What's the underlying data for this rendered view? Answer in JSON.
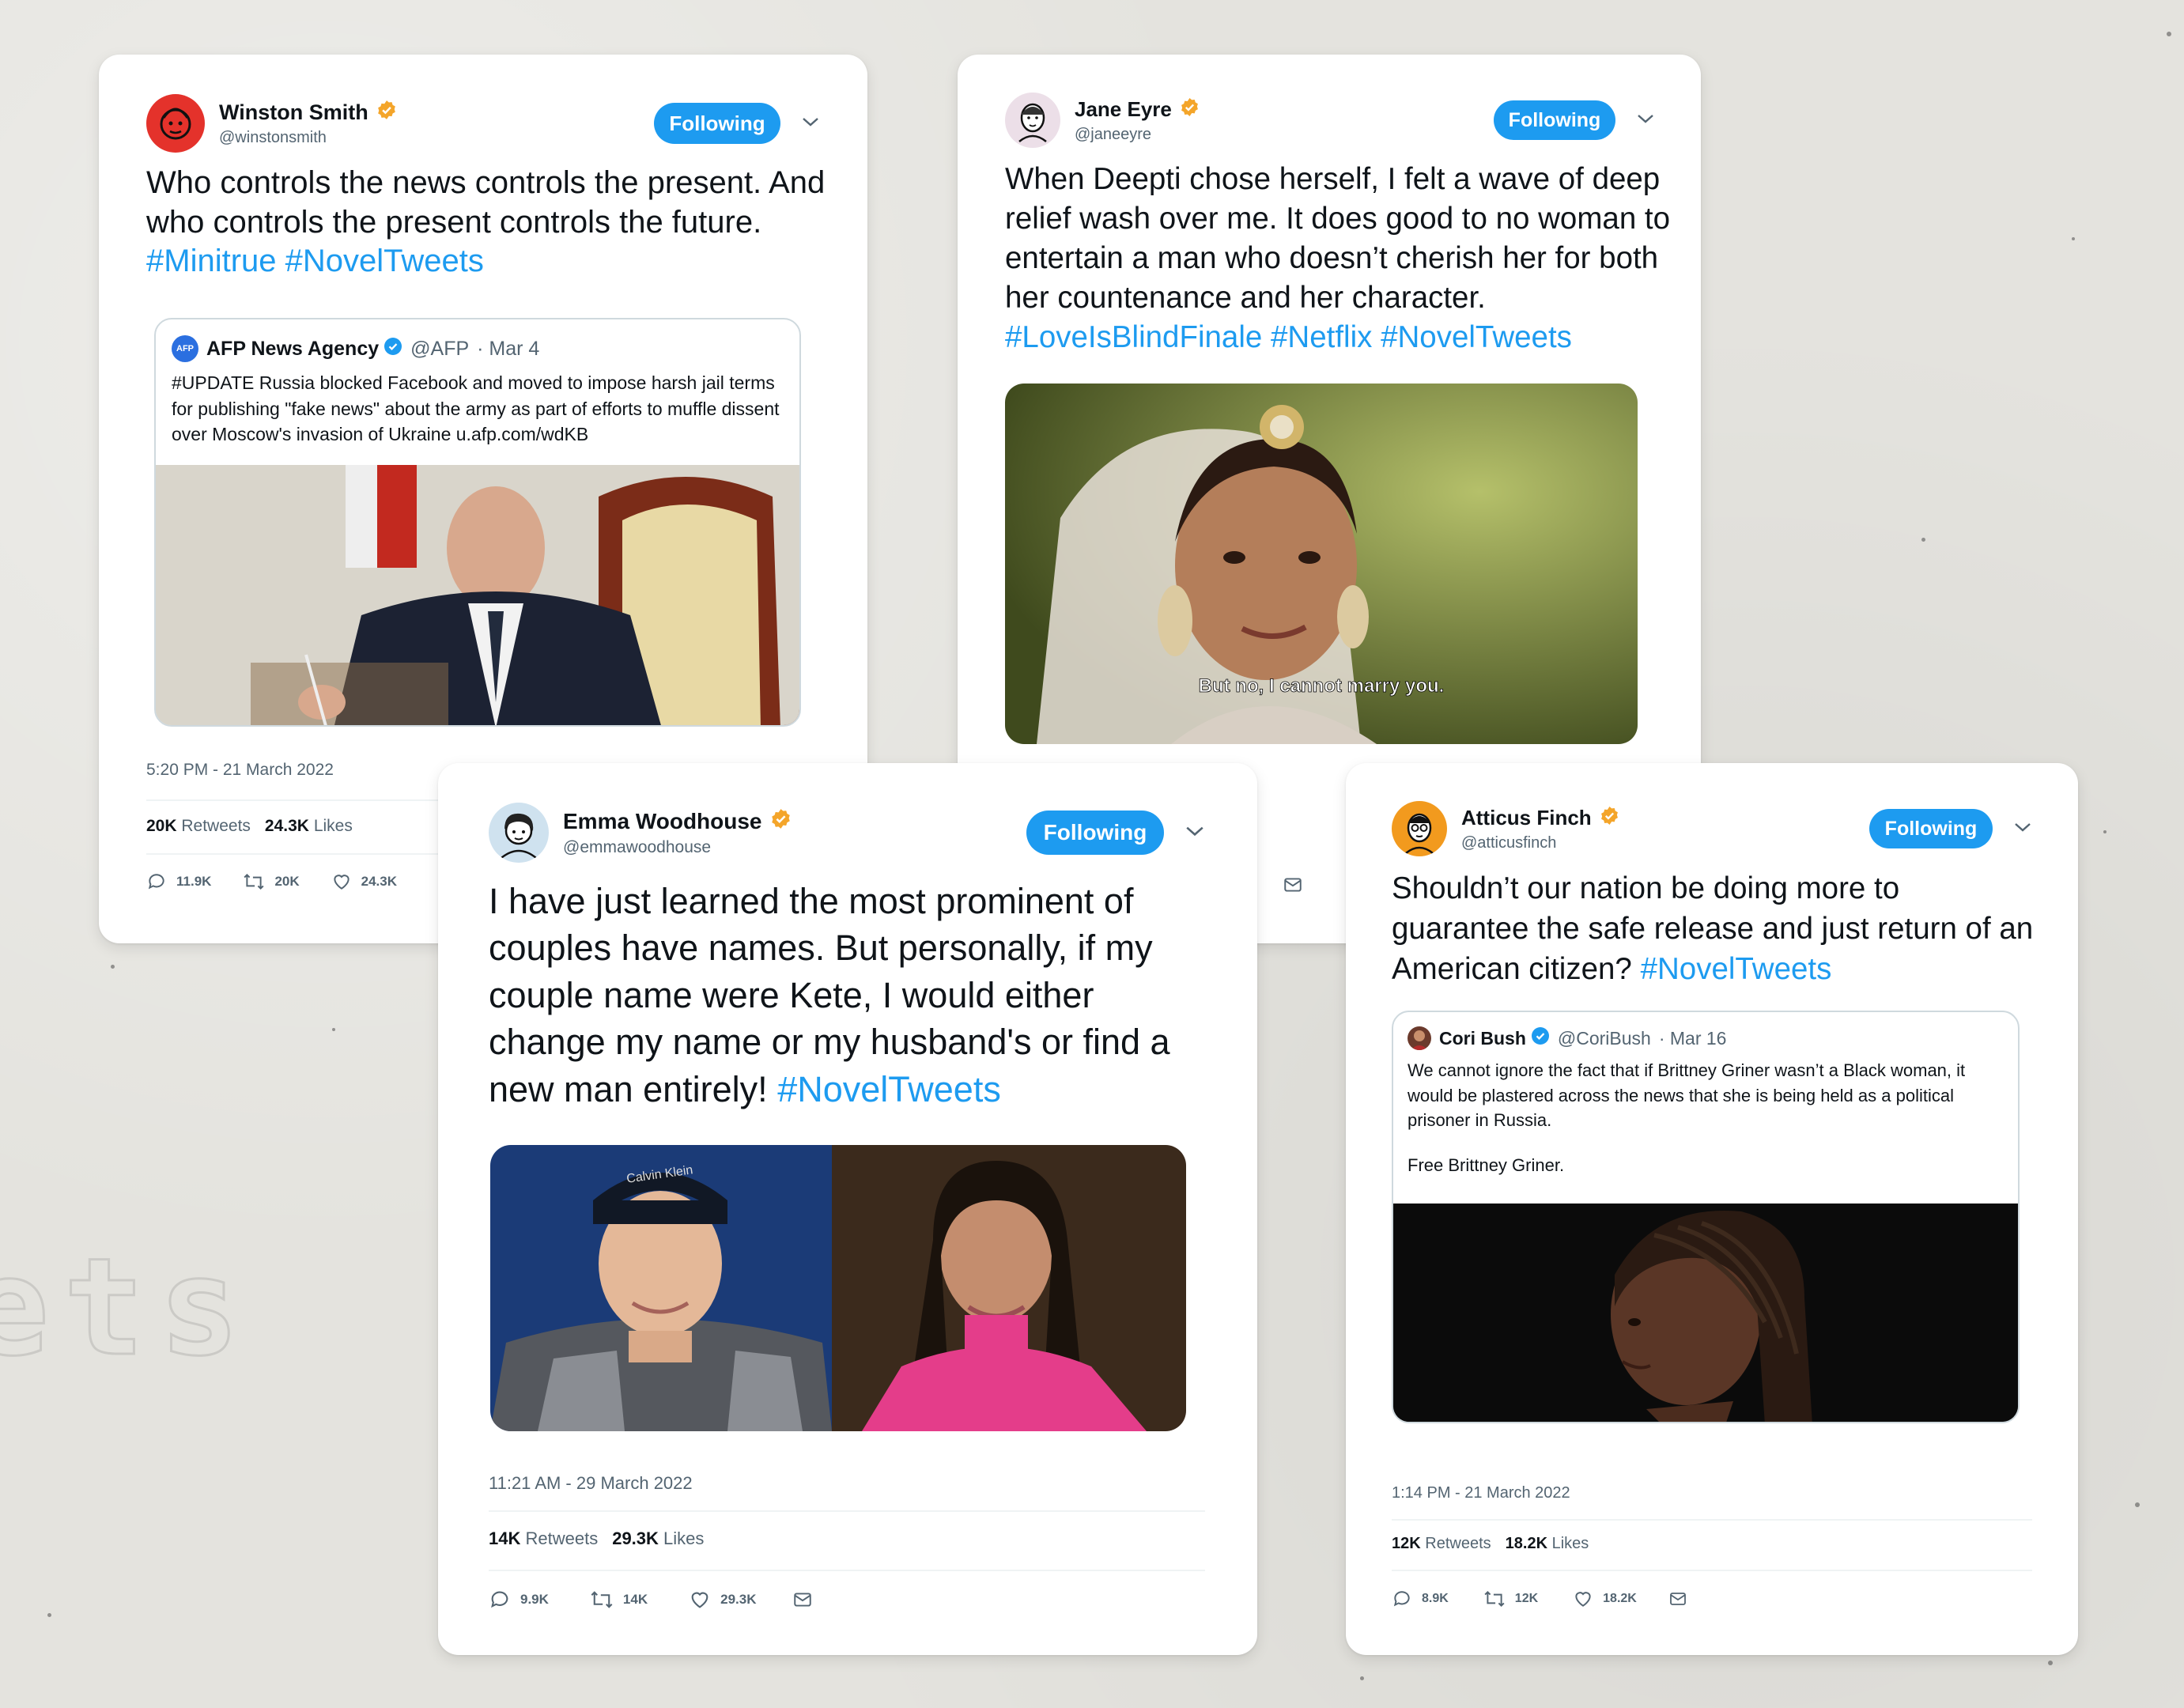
{
  "cards": {
    "winston": {
      "name": "Winston Smith",
      "handle": "@winstonsmith",
      "follow_label": "Following",
      "text": "Who controls the news controls the present. And who controls the present controls the future.",
      "hashtags": "#Minitrue #NovelTweets",
      "quote": {
        "name": "AFP News Agency",
        "handle": "@AFP",
        "date": "· Mar 4",
        "avatar_label": "AFP",
        "text": "#UPDATE Russia blocked Facebook and moved to impose harsh jail terms for publishing \"fake news\" about the army as part of efforts to muffle dissent over Moscow's invasion of Ukraine u.afp.com/wdKB"
      },
      "time": "5:20 PM - 21 March 2022",
      "retweets": "20K",
      "retweets_label": "Retweets",
      "likes": "24.3K",
      "likes_label": "Likes",
      "reply_count": "11.9K",
      "retweet_count": "20K",
      "like_count": "24.3K"
    },
    "jane": {
      "name": "Jane Eyre",
      "handle": "@janeeyre",
      "follow_label": "Following",
      "text": "When Deepti chose herself, I felt a wave of deep relief wash over me. It does good to no woman to entertain a man who doesn’t cherish her for both her countenance and her character.",
      "hashtags": "#LoveIsBlindFinale #Netflix #NovelTweets",
      "caption": "But no, I cannot marry you."
    },
    "emma": {
      "name": "Emma Woodhouse",
      "handle": "@emmawoodhouse",
      "follow_label": "Following",
      "text": "I have just learned the most prominent of couples have names. But personally, if my couple name were Kete, I would either change my name or my husband's or find a new man entirely!",
      "hashtags": "#NovelTweets",
      "cap_text": "Calvin Klein",
      "time": "11:21 AM - 29 March 2022",
      "retweets": "14K",
      "retweets_label": "Retweets",
      "likes": "29.3K",
      "likes_label": "Likes",
      "reply_count": "9.9K",
      "retweet_count": "14K",
      "like_count": "29.3K"
    },
    "atticus": {
      "name": "Atticus Finch",
      "handle": "@atticusfinch",
      "follow_label": "Following",
      "text": "Shouldn’t our nation be doing more to guarantee the safe release and just return of an American citizen?",
      "hashtags": "#NovelTweets",
      "quote": {
        "name": "Cori Bush",
        "handle": "@CoriBush",
        "date": "· Mar 16",
        "text": "We cannot ignore the fact that if Brittney Griner wasn’t a Black woman, it would be plastered across the news that she is being held as a political prisoner in Russia.",
        "text2": "Free Brittney Griner."
      },
      "time": "1:14 PM - 21 March 2022",
      "retweets": "12K",
      "retweets_label": "Retweets",
      "likes": "18.2K",
      "likes_label": "Likes",
      "reply_count": "8.9K",
      "retweet_count": "12K",
      "like_count": "18.2K"
    }
  },
  "background_text": "ets",
  "colors": {
    "accent": "#1d9bf0",
    "verified": "#f4a52a",
    "background": "#e4e3de"
  },
  "icons": [
    "verified-badge-icon",
    "chevron-down-icon",
    "reply-icon",
    "retweet-icon",
    "like-icon",
    "share-icon"
  ]
}
